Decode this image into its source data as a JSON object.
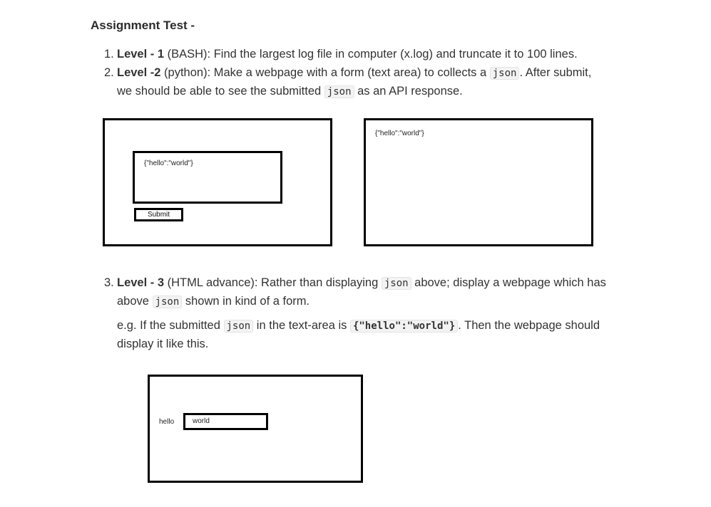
{
  "title": "Assignment Test -",
  "items": [
    {
      "number": "1.",
      "label": "Level - 1",
      "line1_rest": " (BASH): Find the largest log file in computer (x.log) and truncate it to 100 lines."
    },
    {
      "number": "2.",
      "label": "Level -2",
      "line1_a": " (python): Make a webpage with a form (text area) to collects a ",
      "code1": "json",
      "line1_b": ". After submit,",
      "line2_a": "we should be able to see the submitted ",
      "code2": "json",
      "line2_b": " as an API response."
    },
    {
      "number": "3.",
      "label": "Level - 3",
      "line1_a": " (HTML advance): Rather than displaying ",
      "code1": "json",
      "line1_b": " above; display a webpage which has",
      "line2_a": "above ",
      "code2": "json",
      "line2_b": " shown in kind of a form.",
      "eg_a": "e.g. If the submitted ",
      "eg_code1": "json",
      "eg_b": " in the text-area is ",
      "eg_code2": "{\"hello\":\"world\"}",
      "eg_c": ". Then the webpage should",
      "eg_line2": "display it like this."
    }
  ],
  "mockup_form": {
    "textarea_value": "{\"hello\":\"world\"}",
    "submit_label": "Submit"
  },
  "mockup_response": {
    "text": "{\"hello\":\"world\"}"
  },
  "mockup_rendered": {
    "key_label": "hello",
    "value": "world"
  }
}
